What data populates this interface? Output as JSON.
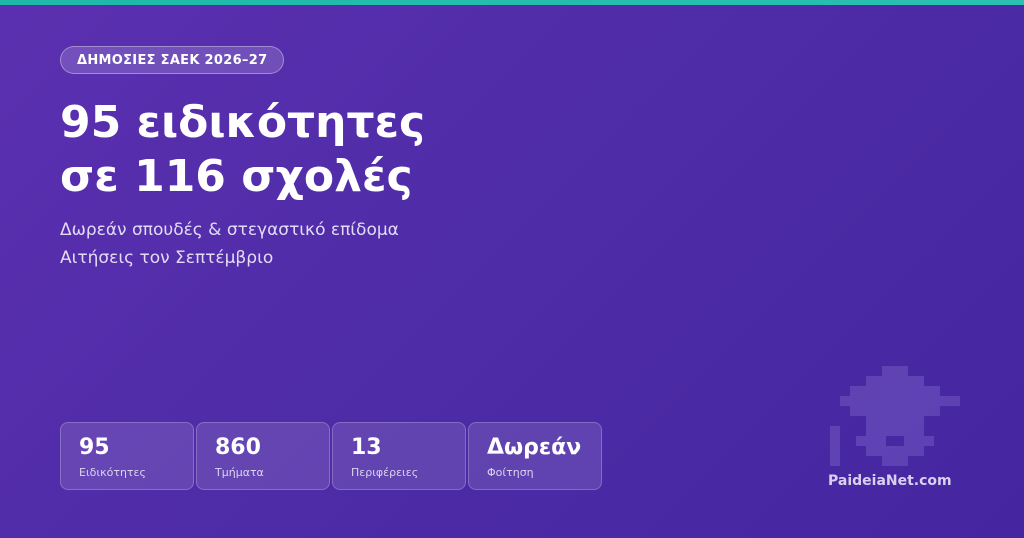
{
  "header": {
    "badge": "ΔΗΜΟΣΙΕΣ ΣΑΕΚ 2026–27",
    "headline_line1": "95 ειδικότητες",
    "headline_line2": "σε 116 σχολές",
    "subtitle_line1": "Δωρεάν σπουδές & στεγαστικό επίδομα",
    "subtitle_line2": "Αιτήσεις τον Σεπτέμβριο"
  },
  "stats": [
    {
      "value": "95",
      "label": "Ειδικότητες"
    },
    {
      "value": "860",
      "label": "Τμήματα"
    },
    {
      "value": "13",
      "label": "Περιφέρειες"
    },
    {
      "value": "Δωρεάν",
      "label": "Φοίτηση"
    }
  ],
  "brand": {
    "name": "PaideiaNet.com",
    "logo_icon": "pixel-graduation-cap-icon"
  },
  "colors": {
    "accent_bar": "#1fb8a6",
    "background": "#5b30b0"
  }
}
